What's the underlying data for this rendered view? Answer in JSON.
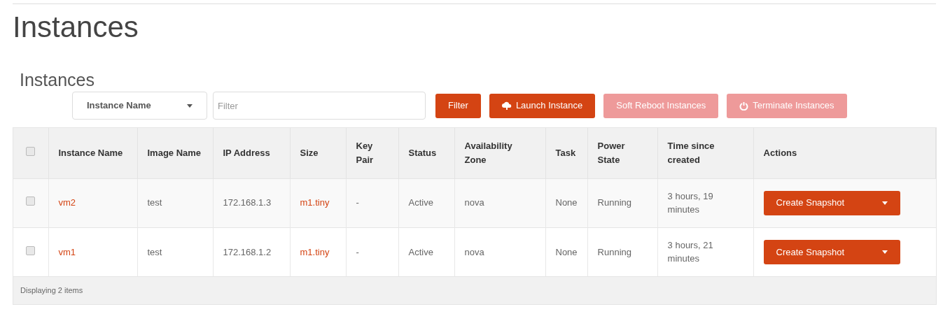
{
  "page_title": "Instances",
  "section_title": "Instances",
  "toolbar": {
    "filter_field": {
      "value": "Instance Name"
    },
    "filter_input": {
      "placeholder": "Filter"
    },
    "buttons": [
      {
        "label": "Filter",
        "disabled": false
      },
      {
        "label": "Launch Instance",
        "disabled": false
      },
      {
        "label": "Soft Reboot Instances",
        "disabled": true
      },
      {
        "label": "Terminate Instances",
        "disabled": true
      }
    ]
  },
  "table": {
    "select_all": {
      "checked": false
    },
    "columns": [
      "Instance Name",
      "Image Name",
      "IP Address",
      "Size",
      "Key Pair",
      "Status",
      "Availability Zone",
      "Task",
      "Power State",
      "Time since created",
      "Actions"
    ],
    "rows": [
      {
        "checked": false,
        "cells": [
          "vm2",
          "test",
          "172.168.1.3",
          "m1.tiny",
          "-",
          "Active",
          "nova",
          "None",
          "Running",
          "3 hours, 19 minutes"
        ],
        "action": "Create Snapshot"
      },
      {
        "checked": false,
        "cells": [
          "vm1",
          "test",
          "172.168.1.2",
          "m1.tiny",
          "-",
          "Active",
          "nova",
          "None",
          "Running",
          "3 hours, 21 minutes"
        ],
        "action": "Create Snapshot"
      }
    ],
    "footer": "Displaying 2 items"
  }
}
